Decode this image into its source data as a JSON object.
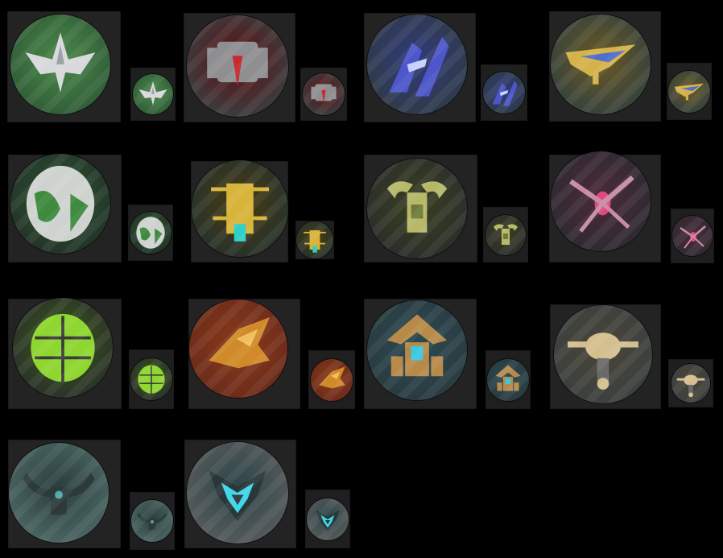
{
  "ships": [
    {
      "icon": "white-fighter-ship-icon",
      "bg": "#2f5a36",
      "hull": "#d9d9dc",
      "accent": "#9aa3a8",
      "glow": "#4a8a4a",
      "shape": "fighter"
    },
    {
      "icon": "red-gunship-ship-icon",
      "bg": "#3a3f40",
      "hull": "#8f8f92",
      "accent": "#c8282e",
      "glow": "#5c1216",
      "shape": "gunship"
    },
    {
      "icon": "blue-winged-ship-icon",
      "bg": "#2f3a45",
      "hull": "#4d57c9",
      "accent": "#c9d0ff",
      "glow": "#303a7a",
      "shape": "winged"
    },
    {
      "icon": "gold-interceptor-ship-icon",
      "bg": "#33403f",
      "hull": "#d6b24a",
      "accent": "#4f6fcf",
      "glow": "#6a5a22",
      "shape": "interceptor"
    },
    {
      "icon": "green-armored-pod-ship-icon",
      "bg": "#22302a",
      "hull": "#cfd3d0",
      "accent": "#3e8a3e",
      "glow": "#2d5a2d",
      "shape": "pod"
    },
    {
      "icon": "yellow-cage-ship-icon",
      "bg": "#24312d",
      "hull": "#d8b43a",
      "accent": "#2fd0c8",
      "glow": "#4a3c12",
      "shape": "cage"
    },
    {
      "icon": "olive-claw-ship-icon",
      "bg": "#2a2d2a",
      "hull": "#b7b86a",
      "accent": "#6f7a3a",
      "glow": "#3a3f22",
      "shape": "claw"
    },
    {
      "icon": "pink-spider-ship-icon",
      "bg": "#2d2a31",
      "hull": "#c88aa6",
      "accent": "#e04a7a",
      "glow": "#4a2a38",
      "shape": "spider"
    },
    {
      "icon": "lime-beetle-ship-icon",
      "bg": "#2a2f2a",
      "hull": "#8ed630",
      "accent": "#3a3a3a",
      "glow": "#3a5a1a",
      "shape": "beetle"
    },
    {
      "icon": "orange-raptor-ship-icon",
      "bg": "#6a2a1a",
      "hull": "#d08a2a",
      "accent": "#f0c060",
      "glow": "#8a3a1a",
      "shape": "raptor"
    },
    {
      "icon": "teal-fortress-ship-icon",
      "bg": "#2a3a3f",
      "hull": "#b88a4a",
      "accent": "#3ac8e0",
      "glow": "#2a4a52",
      "shape": "fortress"
    },
    {
      "icon": "tan-gyro-ship-icon",
      "bg": "#3a403f",
      "hull": "#d4bf90",
      "accent": "#6a6a6a",
      "glow": "#4a4438",
      "shape": "gyro"
    },
    {
      "icon": "dark-crab-ship-icon",
      "bg": "#4c6764",
      "hull": "#2c3b3a",
      "accent": "#4fa8a8",
      "glow": "#2a3f3d",
      "shape": "crab"
    },
    {
      "icon": "cyan-emblem-icon",
      "bg": "#585b5c",
      "hull": "#29363a",
      "accent": "#3fd7ea",
      "glow": "#2c4548",
      "shape": "emblem"
    }
  ]
}
